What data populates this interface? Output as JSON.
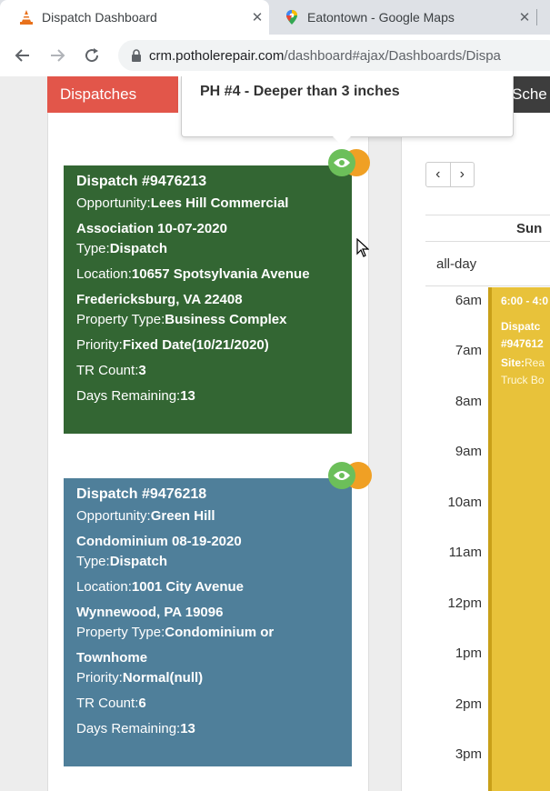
{
  "browser": {
    "tabs": [
      {
        "title": "Dispatch Dashboard",
        "icon": "traffic-cone-icon"
      },
      {
        "title": "Eatontown - Google Maps",
        "icon": "google-maps-pin-icon"
      }
    ],
    "url_host": "crm.potholerepair.com",
    "url_path": "/dashboard#ajax/Dashboards/Dispa"
  },
  "panels": {
    "dispatches_tab": "Dispatches",
    "schedule_tab": "Sche"
  },
  "tooltip": {
    "text": "PH #4 - Deeper than 3 inches"
  },
  "cards": [
    {
      "title": "Dispatch #9476213",
      "opportunity_label": "Opportunity:",
      "opportunity_value": "Lees Hill Commercial",
      "opportunity_value2": "Association 10-07-2020",
      "type_label": "Type:",
      "type_value": "Dispatch",
      "location_label": "Location:",
      "location_value": "10657 Spotsylvania Avenue",
      "location_value2": "Fredericksburg, VA 22408",
      "property_label": "Property Type:",
      "property_value": "Business Complex",
      "property_value2": "",
      "priority_label": "Priority:",
      "priority_value": "Fixed Date(10/21/2020)",
      "tr_label": "TR Count:",
      "tr_value": "3",
      "days_label": "Days Remaining:",
      "days_value": "13",
      "color": "#336633"
    },
    {
      "title": "Dispatch #9476218",
      "opportunity_label": "Opportunity:",
      "opportunity_value": "Green Hill",
      "opportunity_value2": "Condominium 08-19-2020",
      "type_label": "Type:",
      "type_value": "Dispatch",
      "location_label": "Location:",
      "location_value": "1001 City Avenue",
      "location_value2": "Wynnewood, PA 19096",
      "property_label": "Property Type:",
      "property_value": "Condominium or",
      "property_value2": "Townhome",
      "priority_label": "Priority:",
      "priority_value": "Normal(null)",
      "tr_label": "TR Count:",
      "tr_value": "6",
      "days_label": "Days Remaining:",
      "days_value": "13",
      "color": "#4f7f9a"
    }
  ],
  "calendar": {
    "prev": "‹",
    "next": "›",
    "day": "Sun",
    "allday": "all-day",
    "times": [
      "6am",
      "7am",
      "8am",
      "9am",
      "10am",
      "11am",
      "12pm",
      "1pm",
      "2pm",
      "3pm"
    ],
    "event": {
      "time": "6:00 - 4:0",
      "line1": "Dispatc",
      "line2": "#947612",
      "site_label": "Site:",
      "site_value": "Rea",
      "line4": "Truck Bo"
    }
  }
}
